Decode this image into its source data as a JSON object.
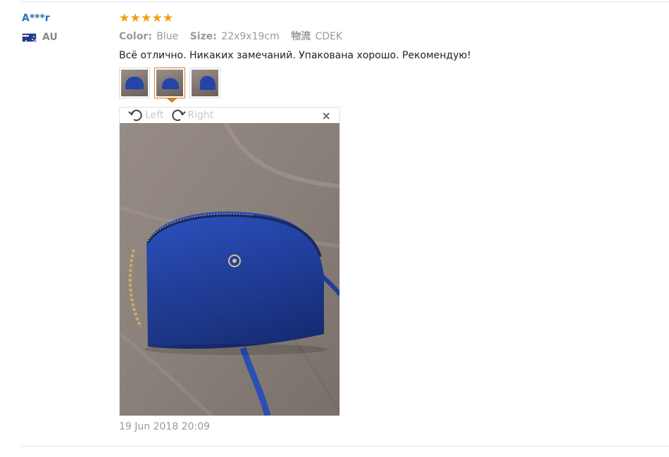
{
  "reviewer": {
    "name": "A***r",
    "country_code": "AU",
    "flag_icon": "australia-flag-icon"
  },
  "review": {
    "rating": 5,
    "rating_max": 5,
    "star_color": "#f59b0d",
    "attributes": [
      {
        "label": "Color:",
        "value": "Blue"
      },
      {
        "label": "Size:",
        "value": "22x9x19cm"
      },
      {
        "label": "物流",
        "value": "CDEK"
      }
    ],
    "text": "Всё отлично. Никаких замечаний. Упакована хорошо. Рекомендую!",
    "date": "19 Jun 2018 20:09"
  },
  "gallery": {
    "thumbnail_count": 3,
    "active_index": 1,
    "accent_color": "#e07b22"
  },
  "viewer": {
    "rotate_left_label": "Left",
    "rotate_right_label": "Right",
    "close_label": "×"
  }
}
